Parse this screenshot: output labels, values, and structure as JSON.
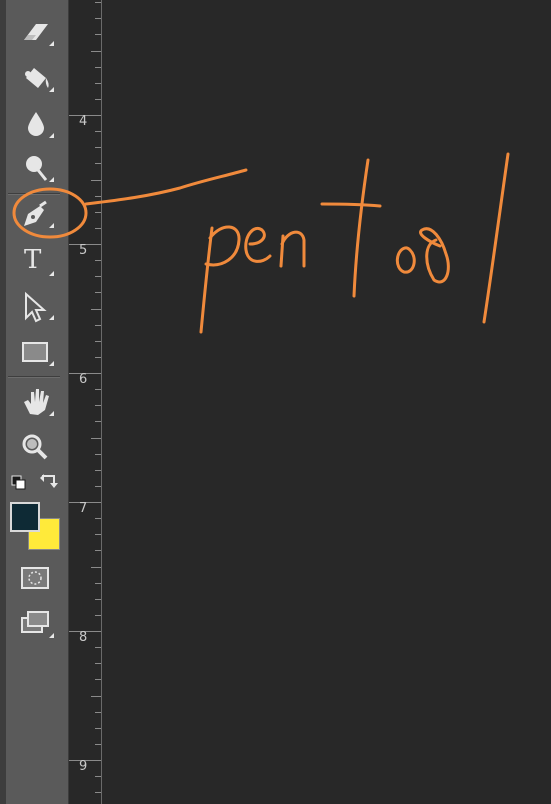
{
  "toolbar": {
    "tools": [
      {
        "name": "eraser-tool-icon"
      },
      {
        "name": "paint-bucket-tool-icon"
      },
      {
        "name": "blur-tool-icon"
      },
      {
        "name": "dodge-tool-icon"
      },
      {
        "name": "pen-tool-icon"
      },
      {
        "name": "type-tool-icon",
        "glyph": "T"
      },
      {
        "name": "path-selection-tool-icon"
      },
      {
        "name": "rectangle-tool-icon"
      },
      {
        "name": "hand-tool-icon"
      },
      {
        "name": "zoom-tool-icon"
      }
    ],
    "foreground_color": "#0e2a35",
    "background_color": "#ffea3a"
  },
  "ruler": {
    "labels": [
      "4",
      "5",
      "6",
      "7",
      "8",
      "9"
    ]
  },
  "annotation": {
    "text": "pentool",
    "color": "#f08a3c"
  }
}
